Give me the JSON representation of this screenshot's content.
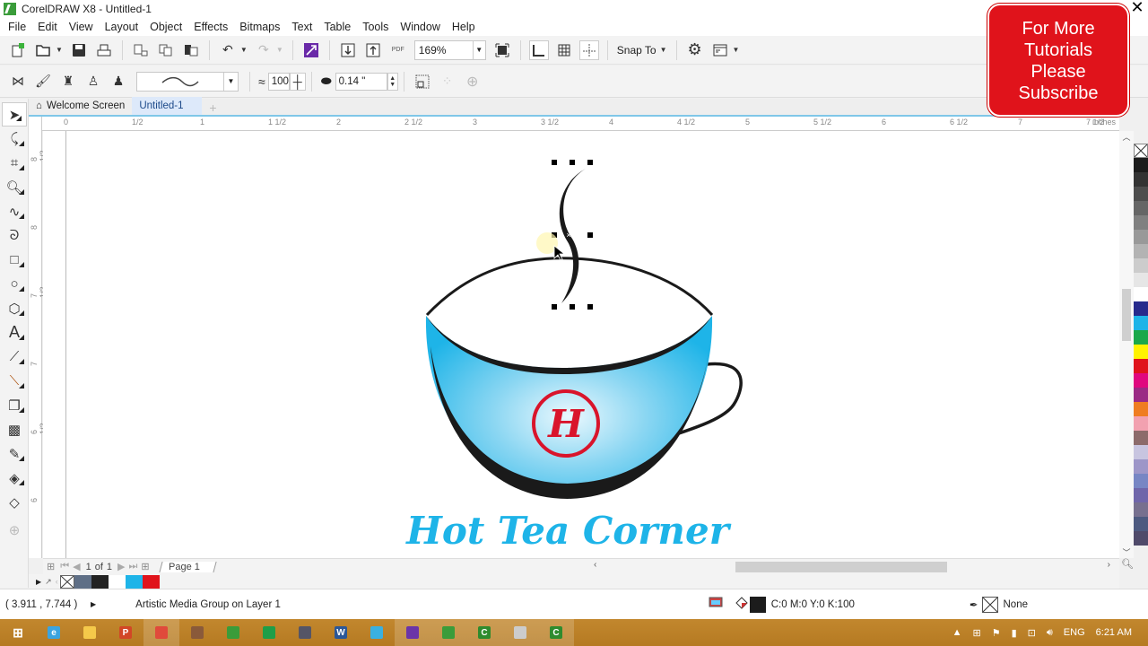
{
  "window": {
    "title": "CorelDRAW X8 - Untitled-1",
    "close_label": "✕"
  },
  "menu": [
    "File",
    "Edit",
    "View",
    "Layout",
    "Object",
    "Effects",
    "Bitmaps",
    "Text",
    "Table",
    "Tools",
    "Window",
    "Help"
  ],
  "toolbar": {
    "zoom_level": "169%",
    "snap_to_label": "Snap To",
    "pdf_label": "PDF"
  },
  "property_bar": {
    "smoothing_value": "100",
    "stroke_width_value": "0.14 \""
  },
  "tabs": [
    {
      "label": "Welcome Screen",
      "icon": "home-icon",
      "active": false
    },
    {
      "label": "Untitled-1",
      "active": true
    }
  ],
  "ruler": {
    "units": "inches",
    "h_labels": [
      "0",
      "1/2",
      "1",
      "1 1/2",
      "2",
      "2 1/2",
      "3",
      "3 1/2",
      "4",
      "4 1/2",
      "5",
      "5 1/2",
      "6",
      "6 1/2",
      "7",
      "7 1/2"
    ],
    "v_labels": [
      "8 1/2",
      "8",
      "7 1/2",
      "7",
      "6 1/2",
      "6"
    ]
  },
  "canvas": {
    "logo_text": "Hot Tea Corner",
    "emblem_letter": "H",
    "colors": {
      "cup_blue": "#1eb4e8",
      "emblem_red": "#d9142b",
      "outline": "#1a1a1a"
    }
  },
  "page_nav": {
    "current": "1",
    "of_label": "of",
    "total": "1",
    "page_tab": "Page 1"
  },
  "doc_palette": [
    "#5f6f86",
    "#222222",
    "#ffffff",
    "#1eb4e8",
    "#e0131b"
  ],
  "color_palette": [
    "#1c1c1c",
    "#333333",
    "#4d4d4d",
    "#666666",
    "#808080",
    "#999999",
    "#b3b3b3",
    "#cccccc",
    "#e6e6e6",
    "#ffffff",
    "#262a8c",
    "#1eb4e8",
    "#1aa84a",
    "#fff200",
    "#e0131b",
    "#e0087f",
    "#9b2a85",
    "#ef7d22",
    "#f2a1b0",
    "#8c6b6b",
    "#c8c5e0",
    "#9d96c8",
    "#7786c4",
    "#6f66aa",
    "#77708f",
    "#4d5a80",
    "#4f4a6a"
  ],
  "status": {
    "coordinates": "( 3.911 , 7.744 )",
    "selection_info": "Artistic Media Group on Layer 1",
    "fill_info": "C:0 M:0 Y:0 K:100",
    "fill_color": "#1c1c1c",
    "outline_info": "None"
  },
  "overlay": {
    "subscribe_lines": [
      "For More",
      "Tutorials",
      "Please",
      "Subscribe"
    ]
  },
  "taskbar": {
    "apps": [
      {
        "name": "start",
        "color": "#fff",
        "label": ""
      },
      {
        "name": "internet-explorer",
        "color": "#3ba4e0",
        "label": "e"
      },
      {
        "name": "file-explorer",
        "color": "#f5c94a",
        "label": ""
      },
      {
        "name": "powerpoint",
        "color": "#d24726",
        "label": "P"
      },
      {
        "name": "chrome",
        "color": "#e04a3b",
        "label": ""
      },
      {
        "name": "media-app",
        "color": "#8a5a3a",
        "label": ""
      },
      {
        "name": "coreldraw",
        "color": "#3a9c3a",
        "label": ""
      },
      {
        "name": "excel-like",
        "color": "#1e9e48",
        "label": ""
      },
      {
        "name": "media-player",
        "color": "#556",
        "label": ""
      },
      {
        "name": "word",
        "color": "#2b5797",
        "label": "W"
      },
      {
        "name": "browser-globe",
        "color": "#3ab0e0",
        "label": ""
      },
      {
        "name": "settings-app",
        "color": "#6a35a8",
        "label": ""
      },
      {
        "name": "coreldraw-active",
        "color": "#3a9c3a",
        "label": ""
      },
      {
        "name": "corel-connect",
        "color": "#2e8b2e",
        "label": "C"
      },
      {
        "name": "paint-app",
        "color": "#ccc",
        "label": ""
      },
      {
        "name": "corel-capture",
        "color": "#2e8b2e",
        "label": "C"
      }
    ],
    "language": "ENG",
    "time": "6:21 AM"
  }
}
